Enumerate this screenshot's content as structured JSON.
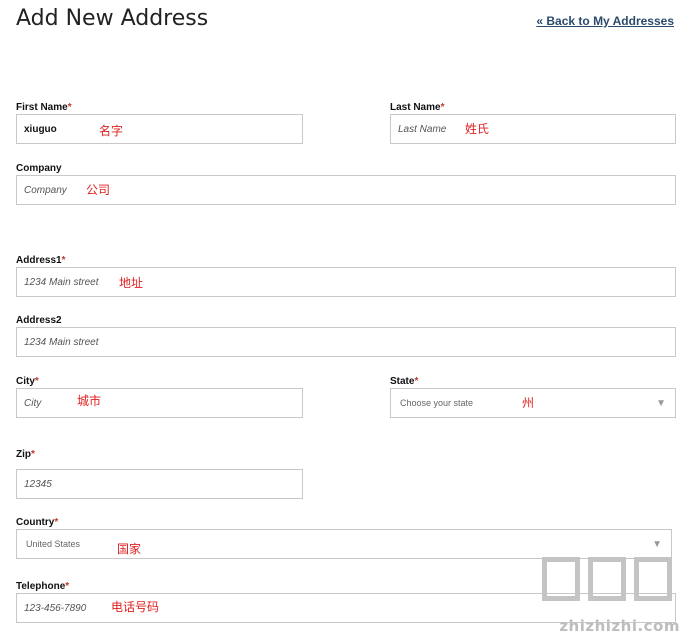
{
  "header": {
    "title": "Add New Address",
    "back_link": "« Back to My Addresses"
  },
  "form": {
    "first_name": {
      "label": "First Name",
      "required": "*",
      "value": "xiuguo",
      "annotation": "名字"
    },
    "last_name": {
      "label": "Last Name",
      "required": "*",
      "placeholder": "Last Name",
      "annotation": "姓氏"
    },
    "company": {
      "label": "Company",
      "placeholder": "Company",
      "annotation": "公司"
    },
    "address1": {
      "label": "Address1",
      "required": "*",
      "placeholder": "1234 Main street",
      "annotation": "地址"
    },
    "address2": {
      "label": "Address2",
      "placeholder": "1234 Main street"
    },
    "city": {
      "label": "City",
      "required": "*",
      "placeholder": "City",
      "annotation": "城市"
    },
    "state": {
      "label": "State",
      "required": "*",
      "selected": "Choose your state",
      "annotation": "州"
    },
    "zip": {
      "label": "Zip",
      "required": "*",
      "placeholder": "12345"
    },
    "country": {
      "label": "Country",
      "required": "*",
      "selected": "United States",
      "annotation": "国家"
    },
    "telephone": {
      "label": "Telephone",
      "required": "*",
      "placeholder": "123-456-7890",
      "annotation": "电话号码"
    }
  },
  "icons": {
    "dropdown": "chevron-down-icon"
  },
  "colors": {
    "required": "#c0392b",
    "annotation": "#e02020",
    "link": "#2b4a6b",
    "border": "#c8c8c8"
  },
  "watermark": {
    "text": "zhizhizhi.com"
  }
}
